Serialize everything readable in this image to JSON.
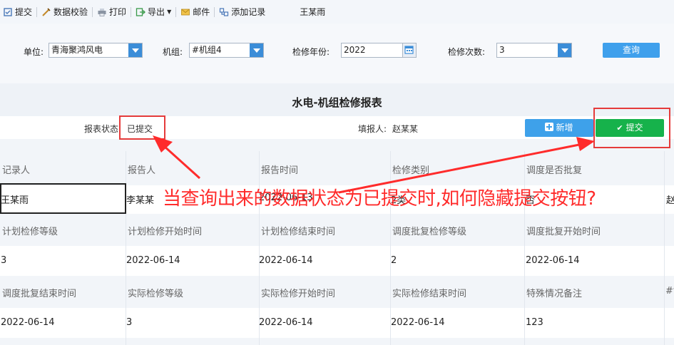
{
  "toolbar": {
    "items": [
      {
        "label": "提交",
        "icon": "submit-icon"
      },
      {
        "label": "数据校验",
        "icon": "validate-icon"
      },
      {
        "label": "打印",
        "icon": "print-icon"
      },
      {
        "label": "导出",
        "icon": "export-icon"
      },
      {
        "label": "邮件",
        "icon": "mail-icon"
      },
      {
        "label": "添加记录",
        "icon": "add-record-icon"
      }
    ],
    "user": "王某雨"
  },
  "filters": {
    "unit_label": "单位:",
    "unit_value": "青海聚鸿风电",
    "unitgroup_label": "机组:",
    "unitgroup_value": "#机组4",
    "year_label": "检修年份:",
    "year_value": "2022",
    "count_label": "检修次数:",
    "count_value": "3",
    "query_label": "查询"
  },
  "report": {
    "title": "水电-机组检修报表",
    "status_label": "报表状态:",
    "status_value": "已提交",
    "filler_label": "填报人:",
    "filler_value": "赵某某",
    "new_label": "新增",
    "submit_label": "提交"
  },
  "table": {
    "rows": [
      {
        "headers": [
          "记录人",
          "报告人",
          "报告时间",
          "检修类别",
          "调度是否批复"
        ],
        "values": [
          "王某雨",
          "李某某",
          "2022-06-13",
          "2类",
          "否"
        ]
      },
      {
        "headers": [
          "计划检修等级",
          "计划检修开始时间",
          "计划检修结束时间",
          "调度批复检修等级",
          "调度批复开始时间"
        ],
        "values": [
          "3",
          "2022-06-14",
          "2022-06-14",
          "2",
          "2022-06-14"
        ]
      },
      {
        "headers": [
          "调度批复结束时间",
          "实际检修等级",
          "实际检修开始时间",
          "实际检修结束时间",
          "特殊情况备注"
        ],
        "values": [
          "2022-06-14",
          "3",
          "2022-06-14",
          "2022-06-14",
          "123"
        ]
      }
    ],
    "edge_row1": "赵",
    "edge_row3": "#t"
  },
  "annotation": {
    "text": "当查询出来的数据状态为已提交时,如何隐藏提交按钮?"
  },
  "colors": {
    "accent_blue": "#3fa0ec",
    "submit_green": "#16b24b",
    "annotation_red": "#ff2b2b"
  }
}
